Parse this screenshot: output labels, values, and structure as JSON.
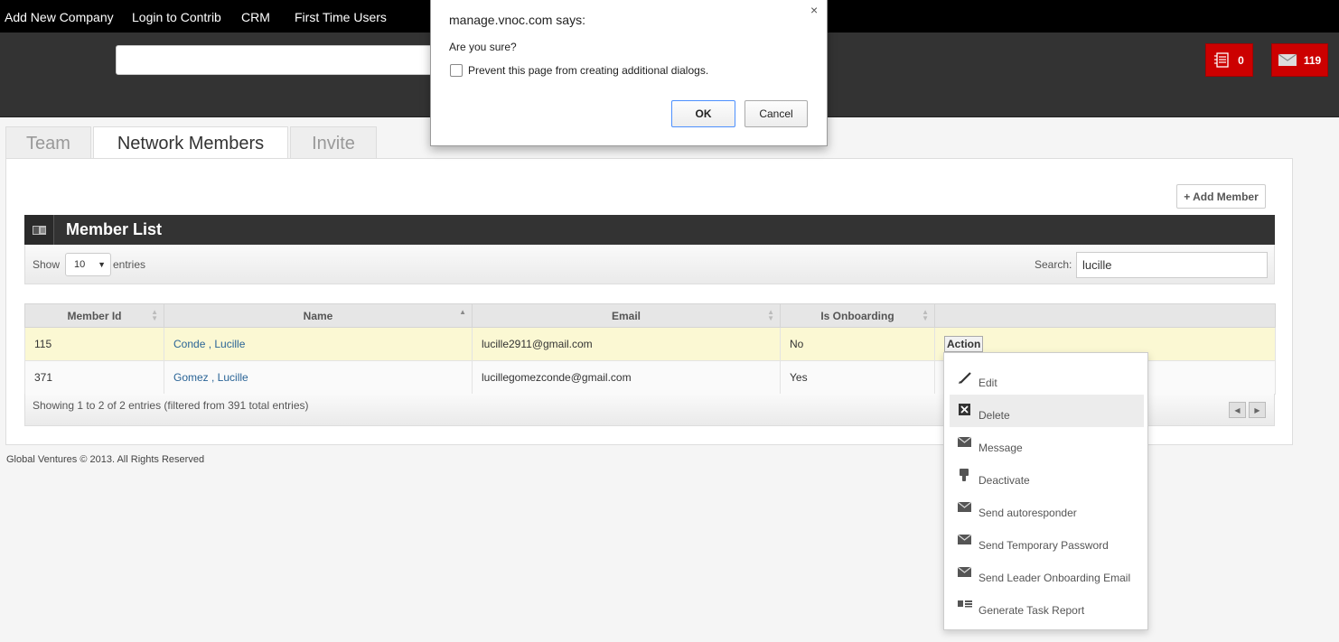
{
  "topnav": {
    "items": [
      {
        "label": "Add New Company"
      },
      {
        "label": "Login to Contrib"
      },
      {
        "label": "CRM"
      },
      {
        "label": "First Time Users"
      }
    ]
  },
  "header": {
    "notifications": {
      "icon": "list-icon",
      "count": "0",
      "color": "#cc0000"
    },
    "messages": {
      "icon": "envelope-icon",
      "count": "119",
      "color": "#cc0000"
    }
  },
  "tabs": [
    {
      "label": "Team",
      "active": false
    },
    {
      "label": "Network Members",
      "active": true
    },
    {
      "label": "Invite",
      "active": false
    }
  ],
  "panel": {
    "add_member_label": "+ Add Member",
    "list_title": "Member List",
    "show_label": "Show",
    "page_size": "10",
    "entries_label": "entries",
    "search_label": "Search:",
    "search_value": "lucille"
  },
  "table": {
    "columns": [
      "Member Id",
      "Name",
      "Email",
      "Is Onboarding",
      ""
    ],
    "sorted_column": "Name",
    "rows": [
      {
        "id": "115",
        "name": "Conde , Lucille",
        "email": "lucille2911@gmail.com",
        "onboarding": "No",
        "action": "Action",
        "highlighted": true
      },
      {
        "id": "371",
        "name": "Gomez , Lucille",
        "email": "lucillegomezconde@gmail.com",
        "onboarding": "Yes",
        "action": "",
        "highlighted": false
      }
    ],
    "info": "Showing 1 to 2 of 2 entries (filtered from 391 total entries)"
  },
  "action_menu": {
    "items": [
      {
        "label": "Edit",
        "icon": "pencil-icon"
      },
      {
        "label": "Delete",
        "icon": "delete-icon",
        "hover": true
      },
      {
        "label": "Message",
        "icon": "envelope-icon"
      },
      {
        "label": "Deactivate",
        "icon": "thumbs-down-icon"
      },
      {
        "label": "Send autoresponder",
        "icon": "envelope-icon"
      },
      {
        "label": "Send Temporary Password",
        "icon": "envelope-icon"
      },
      {
        "label": "Send Leader Onboarding Email",
        "icon": "envelope-icon"
      },
      {
        "label": "Generate Task Report",
        "icon": "list-icon"
      }
    ]
  },
  "footer": {
    "copyright": "Global Ventures © 2013. All Rights Reserved"
  },
  "dialog": {
    "title": "manage.vnoc.com says:",
    "close": "×",
    "message": "Are you sure?",
    "checkbox_label": "Prevent this page from creating additional dialogs.",
    "checkbox_checked": false,
    "ok_label": "OK",
    "cancel_label": "Cancel"
  }
}
